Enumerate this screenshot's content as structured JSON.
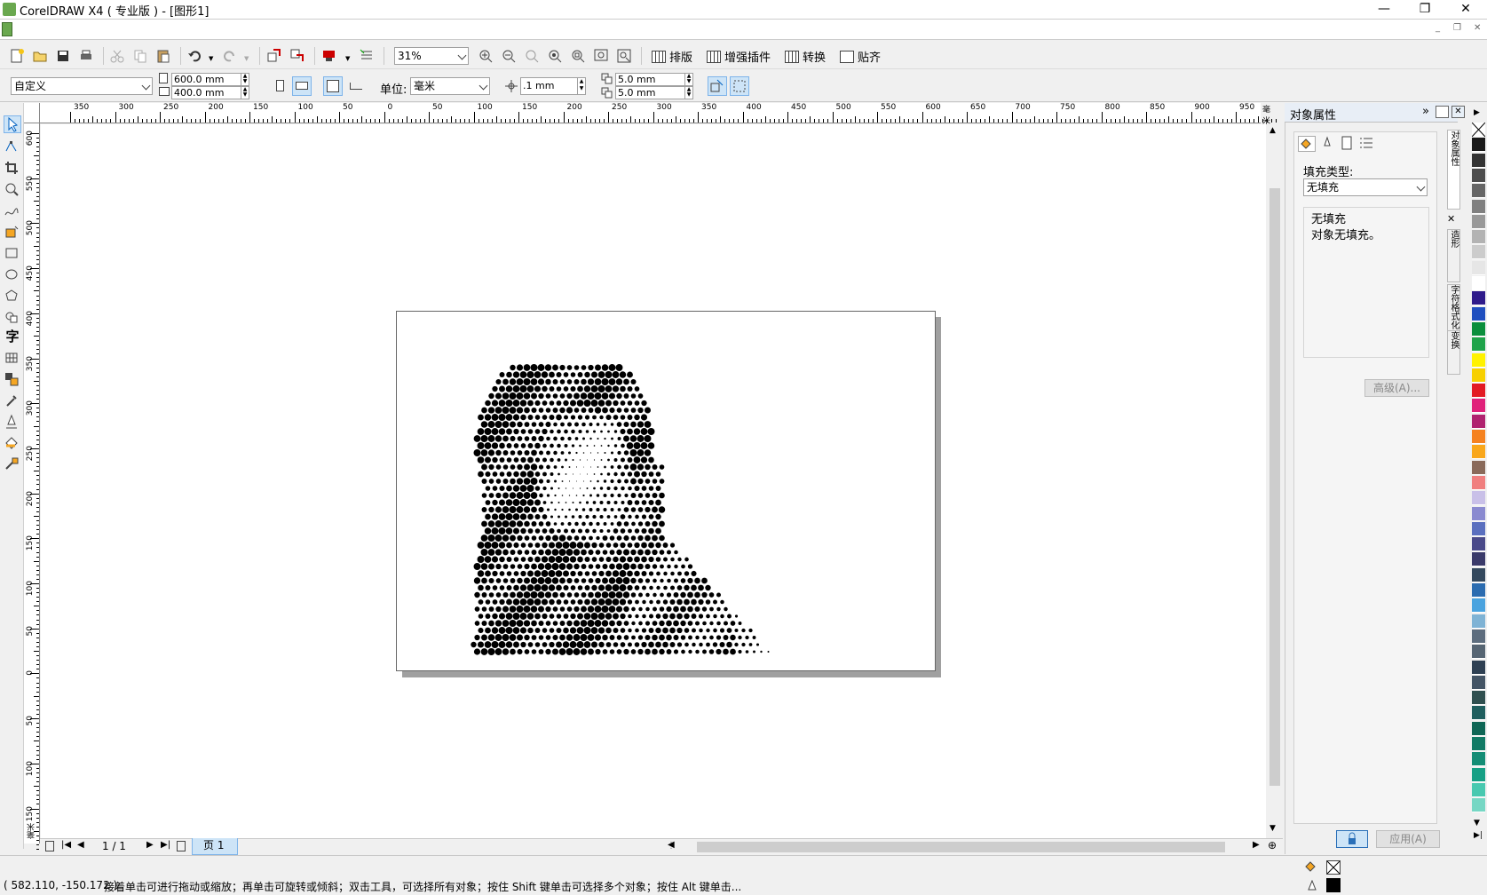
{
  "window": {
    "title": "CorelDRAW X4 ( 专业版 ) - [图形1]",
    "minimize_glyph": "—",
    "restore_glyph": "❐",
    "close_glyph": "✕"
  },
  "mdi": {
    "min": "_",
    "restore": "❐",
    "close": "✕"
  },
  "toolbar": {
    "zoom_value": "31%",
    "btn_layout": "排版",
    "btn_plugins": "增强插件",
    "btn_convert": "转换",
    "btn_snap": "贴齐"
  },
  "property_bar": {
    "preset": "自定义",
    "width": "600.0 mm",
    "height": "400.0 mm",
    "unit_label": "单位:",
    "unit_value": "毫米",
    "nudge": ".1 mm",
    "dup_x": "5.0 mm",
    "dup_y": "5.0 mm"
  },
  "ruler": {
    "h_ticks": [
      "350",
      "300",
      "250",
      "200",
      "150",
      "100",
      "50",
      "0",
      "50",
      "100",
      "150",
      "200",
      "250",
      "300",
      "350",
      "400",
      "450",
      "500",
      "550",
      "600",
      "650",
      "700",
      "750",
      "800",
      "850",
      "900",
      "950"
    ],
    "h_unit": "毫米",
    "v_ticks": [
      "600",
      "550",
      "500",
      "450",
      "400",
      "350",
      "300",
      "250",
      "200",
      "150",
      "100",
      "50",
      "0",
      "50",
      "100",
      "150"
    ],
    "v_unit": "毫米"
  },
  "page_nav": {
    "counter": "1 / 1",
    "tab_label": "页 1"
  },
  "docker": {
    "title": "对象属性",
    "fill_type_label": "填充类型:",
    "fill_type_value": "无填充",
    "fill_group_title": "无填充",
    "fill_group_desc": "对象无填充。",
    "advanced_btn": "高级(A)...",
    "apply_btn": "应用(A)",
    "side_tabs": [
      "对象属性",
      "造形",
      "字符格式化",
      "变换"
    ]
  },
  "palette": {
    "colors": [
      "#ffffff",
      "#1a1a1a",
      "#333333",
      "#4d4d4d",
      "#666666",
      "#808080",
      "#999999",
      "#b3b3b3",
      "#cccccc",
      "#e6e6e6",
      "#ffffff",
      "#2e1a8a",
      "#1f4fbf",
      "#0a8f3c",
      "#1fa34a",
      "#fff200",
      "#f7d000",
      "#e31b23",
      "#e0217a",
      "#b0226f",
      "#f58220",
      "#f9a71b",
      "#8a6a5a",
      "#f07f7f",
      "#c9c0e8",
      "#8a8ad0",
      "#5a6fbf",
      "#4a4a8a",
      "#3a3a6a",
      "#34495e",
      "#2b6cb0",
      "#4aa3df",
      "#7fb3d5",
      "#5d6d7e",
      "#566573",
      "#2e4053",
      "#445566",
      "#2f4f4f",
      "#1f5e5e",
      "#0e6655",
      "#117a65",
      "#138d75",
      "#16a085",
      "#48c9b0",
      "#76d7c4"
    ]
  },
  "status": {
    "coords": "( 582.110, -150.172 )",
    "hint": "接着单击可进行拖动或缩放；再单击可旋转或倾斜；双击工具，可选择所有对象；按住 Shift 键单击可选择多个对象；按住 Alt 键单击..."
  }
}
